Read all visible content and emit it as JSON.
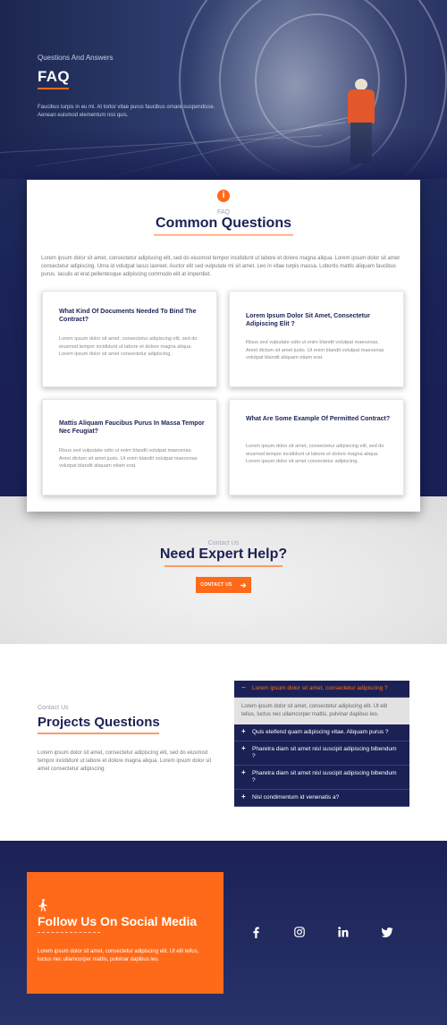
{
  "hero": {
    "kicker": "Questions And Answers",
    "title": "FAQ",
    "description": "Faucibus turpis in eu mi. At tortor vitae purus faucibus ornare suspendisse. Aenean euismod elementum nisi quis."
  },
  "faq": {
    "kicker": "FAQ",
    "title": "Common Questions",
    "description": "Lorem ipsum dolor sit amet, consectetur adipiscing elit, sed do eiusmod tempor incididunt ut labore et dolore magna aliqua. Lorem ipsum dolor sit amet consectetur adipiscing. Urna id volutpat lacus laoreet. Auctor elit sed vulputate mi sit amet. Leo in vitae turpis massa. Lobortis mattis aliquam faucibus purus. Iaculis at erat pellentesque adipiscing commodo elit at imperdiet.",
    "questions": [
      {
        "title": "What Kind Of Documents Needed To Bind The Contract?",
        "body": "Lorem ipsum dolor sit amet, consectetur adipiscing elit, sed do eiusmod tempor incididunt ut labore et dolore magna aliqua. Lorem ipsum dolor sit amet consectetur adipiscing."
      },
      {
        "title": "Lorem Ipsum Dolor Sit Amet, Consectetur Adipiscing Elit ?",
        "body": "Risus sed vulputate odio ut enim blandit volutpat maecenas. Amet dictum sit amet justo. Ut enim blandit volutpat maecenas volutpat blandit aliquam etiam erat."
      },
      {
        "title": "Mattis Aliquam Faucibus Purus In Massa Tempor Nec Feugiat?",
        "body": "Risus sed vulputate odio ut enim blandit volutpat maecenas. Amet dictum sit amet justo. Ut enim blandit volutpat maecenas volutpat blandit aliquam etiam erat."
      },
      {
        "title": "What Are Some Example Of Permitted Contract?",
        "body": "Lorem ipsum dolor sit amet, consectetur adipiscing elit, sed do eiusmod tempor incididunt ut labore et dolore magna aliqua. Lorem ipsum dolor sit amet consectetur adipiscing."
      }
    ]
  },
  "help": {
    "kicker": "Contact Us",
    "title": "Need Expert Help?",
    "button_label": "CONTACT US"
  },
  "projects": {
    "kicker": "Contact Us",
    "title": "Projects Questions",
    "description": "Lorem ipsum dolor sit amet, consectetur adipiscing elit, sed do eiusmod tempor incididunt ut labore et dolore magna aliqua. Lorem ipsum dolor sit amet consectetur adipiscing.",
    "accordion": [
      {
        "sign": "−",
        "label": "Lorem ipsum dolor sit amet, consectetur adipiscing ?",
        "open": true,
        "body": "Lorem ipsum dolor sit amet, consectetur adipiscing elit. Ut elit tellus, luctus nec ullamcorper mattis, pulvinar dapibus leo."
      },
      {
        "sign": "+",
        "label": "Quis eleifend quam adipiscing vitae. Aliquam purus ?"
      },
      {
        "sign": "+",
        "label": "Pharetra diam sit amet nisl suscipit adipiscing bibendum ?"
      },
      {
        "sign": "+",
        "label": "Pharetra diam sit amet nisl suscipit adipiscing bibendum ?"
      },
      {
        "sign": "+",
        "label": "Nisl condimentum id venenatis a?"
      }
    ]
  },
  "footer": {
    "social_title": "Follow Us On Social Media",
    "social_description": "Lorem ipsum dolor sit amet, consectetur adipiscing elit. Ut elit tellus, luctus nec ullamcorper mattis, pulvinar dapibus leo.",
    "social_icons": [
      "facebook-icon",
      "instagram-icon",
      "linkedin-icon",
      "twitter-icon"
    ]
  },
  "colors": {
    "navy": "#1b2155",
    "accent": "#ff6a1a"
  }
}
